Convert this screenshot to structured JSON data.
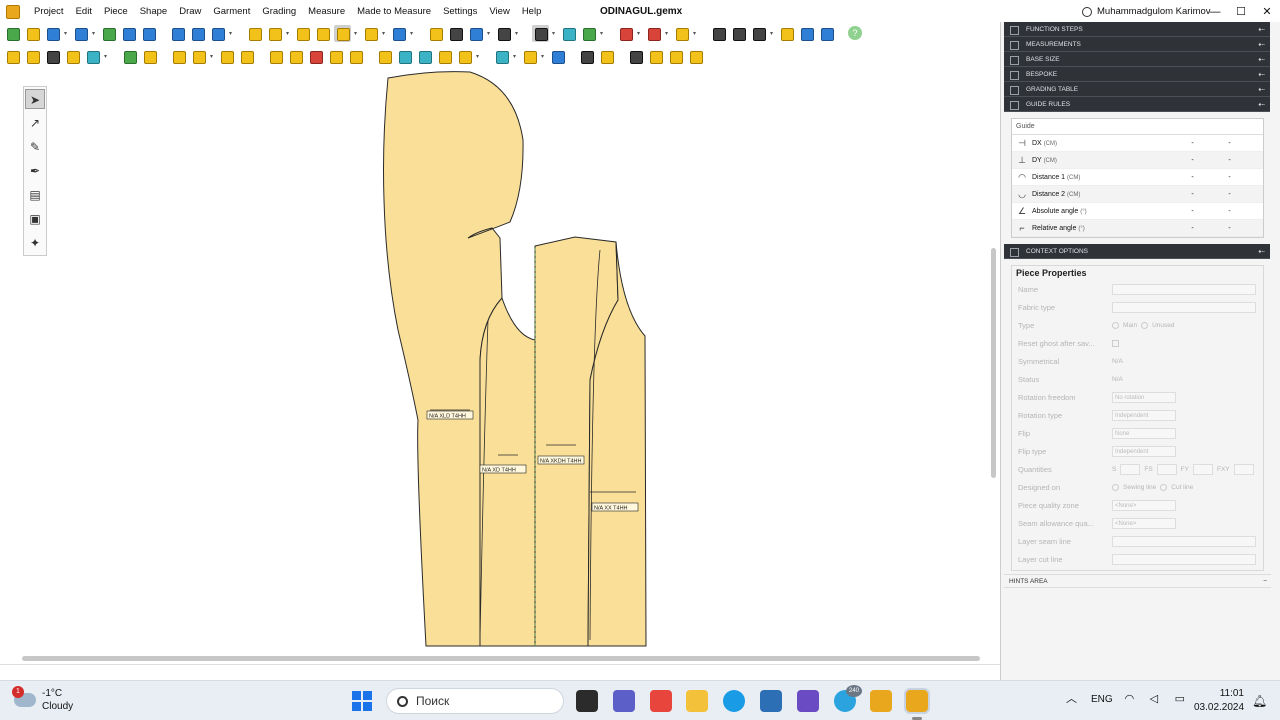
{
  "app": {
    "menu": [
      "Project",
      "Edit",
      "Piece",
      "Shape",
      "Draw",
      "Garment",
      "Grading",
      "Measure",
      "Made to Measure",
      "Settings",
      "View",
      "Help"
    ],
    "document_title": "ODINAGUL.gemx",
    "user_name": "Muhammadgulom Karimov",
    "window_buttons": [
      "—",
      "☐",
      "✕"
    ]
  },
  "panel": {
    "sections_top": [
      {
        "label": "FUNCTION STEPS"
      },
      {
        "label": "MEASUREMENTS"
      },
      {
        "label": "BASE SIZE"
      },
      {
        "label": "BESPOKE"
      },
      {
        "label": "GRADING TABLE"
      },
      {
        "label": "GUIDE RULES"
      }
    ],
    "guide": {
      "header": "Guide",
      "rows": [
        {
          "icon": "⊣",
          "label": "DX",
          "unit": "(CM)",
          "v1": "-",
          "v2": "-"
        },
        {
          "icon": "⊥",
          "label": "DY",
          "unit": "(CM)",
          "v1": "-",
          "v2": "-"
        },
        {
          "icon": "◠",
          "label": "Distance 1",
          "unit": "(CM)",
          "v1": "-",
          "v2": "-"
        },
        {
          "icon": "◡",
          "label": "Distance 2",
          "unit": "(CM)",
          "v1": "-",
          "v2": "-"
        },
        {
          "icon": "∠",
          "label": "Absolute angle",
          "unit": "(°)",
          "v1": "-",
          "v2": "-"
        },
        {
          "icon": "⌐",
          "label": "Relative angle",
          "unit": "(°)",
          "v1": "-",
          "v2": "-"
        }
      ]
    },
    "context_label": "CONTEXT OPTIONS",
    "piece_properties": {
      "title": "Piece Properties",
      "name_label": "Name",
      "fabric_type_label": "Fabric type",
      "type_label": "Type",
      "type_main": "Main",
      "type_unused": "Unused",
      "reset_ghost_label": "Reset ghost after sav...",
      "symmetrical_label": "Symmetrical",
      "symmetrical_value": "N/A",
      "status_label": "Status",
      "status_value": "N/A",
      "rotation_freedom_label": "Rotation freedom",
      "rotation_freedom_value": "No rotation",
      "rotation_type_label": "Rotation type",
      "rotation_type_value": "Independent",
      "flip_label": "Flip",
      "flip_value": "None",
      "flip_type_label": "Flip type",
      "flip_type_value": "Independent",
      "quantities_label": "Quantities",
      "q_s": "S",
      "q_fs": "FS",
      "q_fy": "FY",
      "q_fxy": "FXY",
      "designed_on_label": "Designed on",
      "designed_sewing": "Sewing line",
      "designed_cut": "Cut line",
      "quality_zone_label": "Piece quality zone",
      "quality_zone_value": "<None>",
      "seam_quality_label": "Seam allowance qua...",
      "seam_quality_value": "<None>",
      "layer_seam_label": "Layer seam line",
      "layer_cut_label": "Layer cut line"
    },
    "hints_label": "HINTS AREA"
  },
  "canvas": {
    "piece_labels": [
      "N/A  XLD  T4HH",
      "N/A  XD  T4HH",
      "N/A  XKDH  T4HH",
      "N/A  XX  T4HH"
    ],
    "piece_fill": "#f9df97"
  },
  "taskbar": {
    "weather_temp": "-1°C",
    "weather_desc": "Cloudy",
    "weather_badge": "1",
    "search_placeholder": "Поиск",
    "language": "ENG",
    "time": "11:01",
    "date": "03.02.2024",
    "telegram_badge": "240"
  }
}
